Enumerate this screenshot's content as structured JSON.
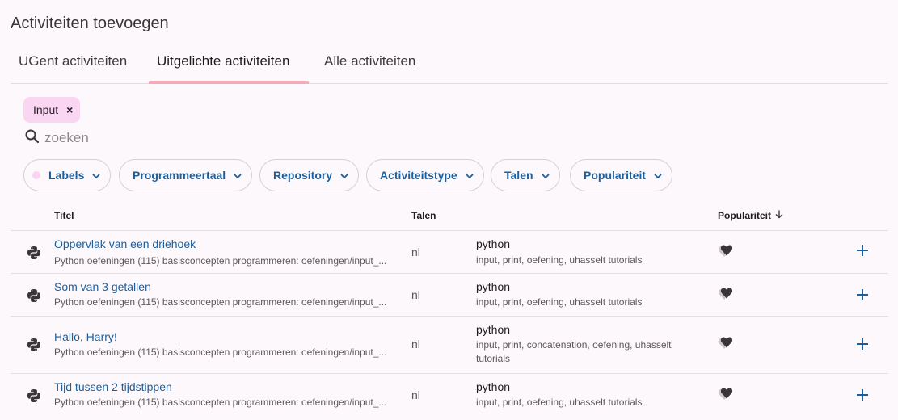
{
  "heading": "Activiteiten toevoegen",
  "tabs": [
    {
      "label": "UGent activiteiten",
      "active": false
    },
    {
      "label": "Uitgelichte activiteiten",
      "active": true
    },
    {
      "label": "Alle activiteiten",
      "active": false
    }
  ],
  "active_filter": {
    "label": "Input",
    "close": "×"
  },
  "search": {
    "placeholder": "zoeken",
    "value": ""
  },
  "filters": [
    "Labels",
    "Programmeertaal",
    "Repository",
    "Activiteitstype",
    "Talen",
    "Populariteit"
  ],
  "table": {
    "headers": {
      "title": "Titel",
      "languages": "Talen",
      "popularity": "Populariteit"
    },
    "rows": [
      {
        "title": "Oppervlak van een driehoek",
        "path": "Python oefeningen (115) basisconcepten programmeren: oefeningen/input_...",
        "lang": "nl",
        "programming_language": "python",
        "tags": "input, print, oefening, uhasselt tutorials"
      },
      {
        "title": "Som van 3 getallen",
        "path": "Python oefeningen (115) basisconcepten programmeren: oefeningen/input_...",
        "lang": "nl",
        "programming_language": "python",
        "tags": "input, print, oefening, uhasselt tutorials"
      },
      {
        "title": "Hallo, Harry!",
        "path": "Python oefeningen (115) basisconcepten programmeren: oefeningen/input_...",
        "lang": "nl",
        "programming_language": "python",
        "tags": "input, print, concatenation, oefening, uhasselt tutorials"
      },
      {
        "title": "Tijd tussen 2 tijdstippen",
        "path": "Python oefeningen (115) basisconcepten programmeren: oefeningen/input_...",
        "lang": "nl",
        "programming_language": "python",
        "tags": "input, print, oefening, uhasselt tutorials"
      }
    ]
  },
  "icons": {
    "search": "magnifier-icon",
    "chevron": "chevron-down-icon",
    "sort": "arrow-down-icon",
    "row_type": "python-icon",
    "popularity": "hearts-icon",
    "add": "plus-icon"
  },
  "colors": {
    "accent": "#1b5f9e",
    "chip": "#fad6f3",
    "tab_underline": "#f4a9b8",
    "background": "#fdf8fb"
  }
}
